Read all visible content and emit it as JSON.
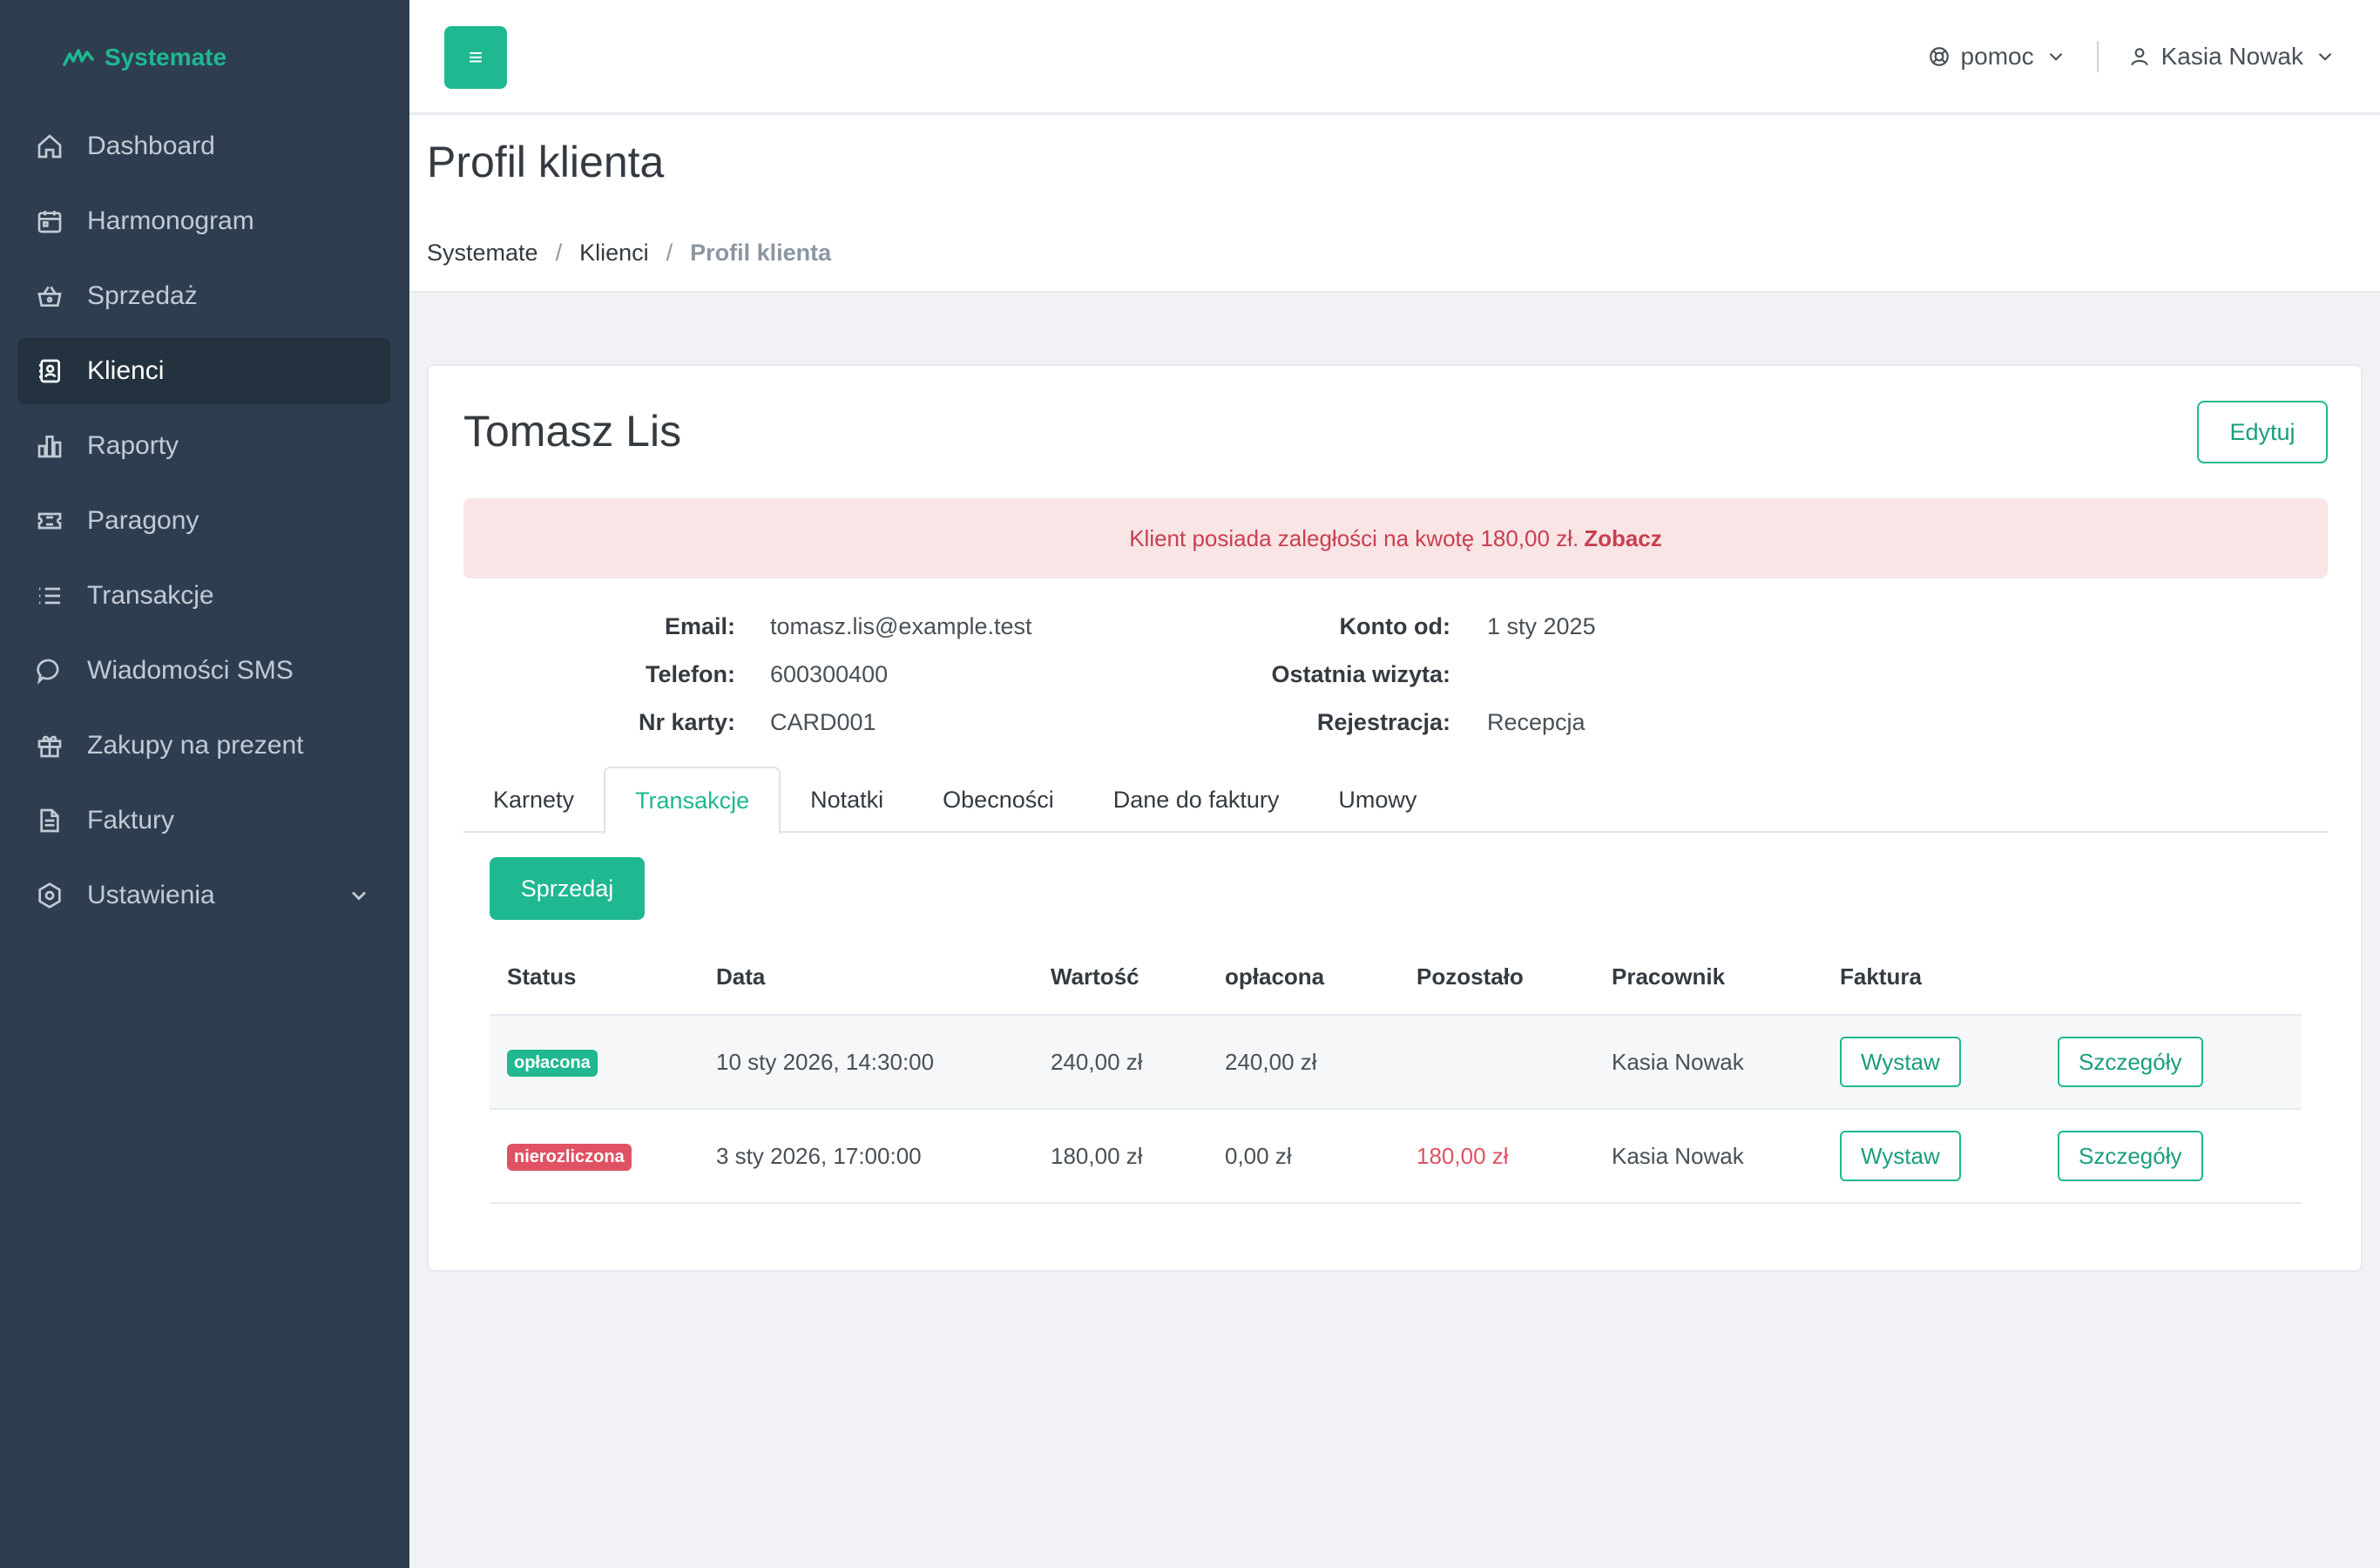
{
  "brand": {
    "name": "Systemate"
  },
  "sidebar": {
    "items": [
      {
        "label": "Dashboard",
        "icon": "home-icon"
      },
      {
        "label": "Harmonogram",
        "icon": "calendar-icon"
      },
      {
        "label": "Sprzedaż",
        "icon": "basket-icon"
      },
      {
        "label": "Klienci",
        "icon": "contacts-icon",
        "active": true
      },
      {
        "label": "Raporty",
        "icon": "bar-chart-icon"
      },
      {
        "label": "Paragony",
        "icon": "ticket-icon"
      },
      {
        "label": "Transakcje",
        "icon": "list-icon"
      },
      {
        "label": "Wiadomości SMS",
        "icon": "chat-icon"
      },
      {
        "label": "Zakupy na prezent",
        "icon": "gift-icon"
      },
      {
        "label": "Faktury",
        "icon": "document-icon"
      },
      {
        "label": "Ustawienia",
        "icon": "settings-icon",
        "expandable": true
      }
    ]
  },
  "topbar": {
    "menu_icon": "≡",
    "help_label": "pomoc",
    "user_name": "Kasia Nowak"
  },
  "page": {
    "title": "Profil klienta",
    "breadcrumb": [
      "Systemate",
      "Klienci",
      "Profil klienta"
    ]
  },
  "client": {
    "name": "Tomasz Lis",
    "edit_label": "Edytuj",
    "alert_text": "Klient posiada zaległości na kwotę 180,00 zł.",
    "alert_link": "Zobacz",
    "info_left": [
      {
        "label": "Email:",
        "value": "tomasz.lis@example.test"
      },
      {
        "label": "Telefon:",
        "value": "600300400"
      },
      {
        "label": "Nr karty:",
        "value": "CARD001"
      }
    ],
    "info_right": [
      {
        "label": "Konto od:",
        "value": "1 sty 2025"
      },
      {
        "label": "Ostatnia wizyta:",
        "value": ""
      },
      {
        "label": "Rejestracja:",
        "value": "Recepcja"
      }
    ]
  },
  "tabs": [
    "Karnety",
    "Transakcje",
    "Notatki",
    "Obecności",
    "Dane do faktury",
    "Umowy"
  ],
  "active_tab": "Transakcje",
  "sell_button": "Sprzedaj",
  "table": {
    "headers": [
      "Status",
      "Data",
      "Wartość",
      "opłacona",
      "Pozostało",
      "Pracownik",
      "Faktura"
    ],
    "rows": [
      {
        "status": "opłacona",
        "status_type": "paid",
        "date": "10 sty 2026, 14:30:00",
        "value": "240,00 zł",
        "paid": "240,00 zł",
        "remaining": "",
        "employee": "Kasia Nowak",
        "invoice_btn": "Wystaw",
        "details_btn": "Szczegóły"
      },
      {
        "status": "nierozliczona",
        "status_type": "unpaid",
        "date": "3 sty 2026, 17:00:00",
        "value": "180,00 zł",
        "paid": "0,00 zł",
        "remaining": "180,00 zł",
        "employee": "Kasia Nowak",
        "invoice_btn": "Wystaw",
        "details_btn": "Szczegóły"
      }
    ]
  },
  "colors": {
    "accent": "#1fb890",
    "sidebar": "#2e3e50",
    "danger": "#e05263",
    "alert_bg": "#f9e4e6"
  }
}
